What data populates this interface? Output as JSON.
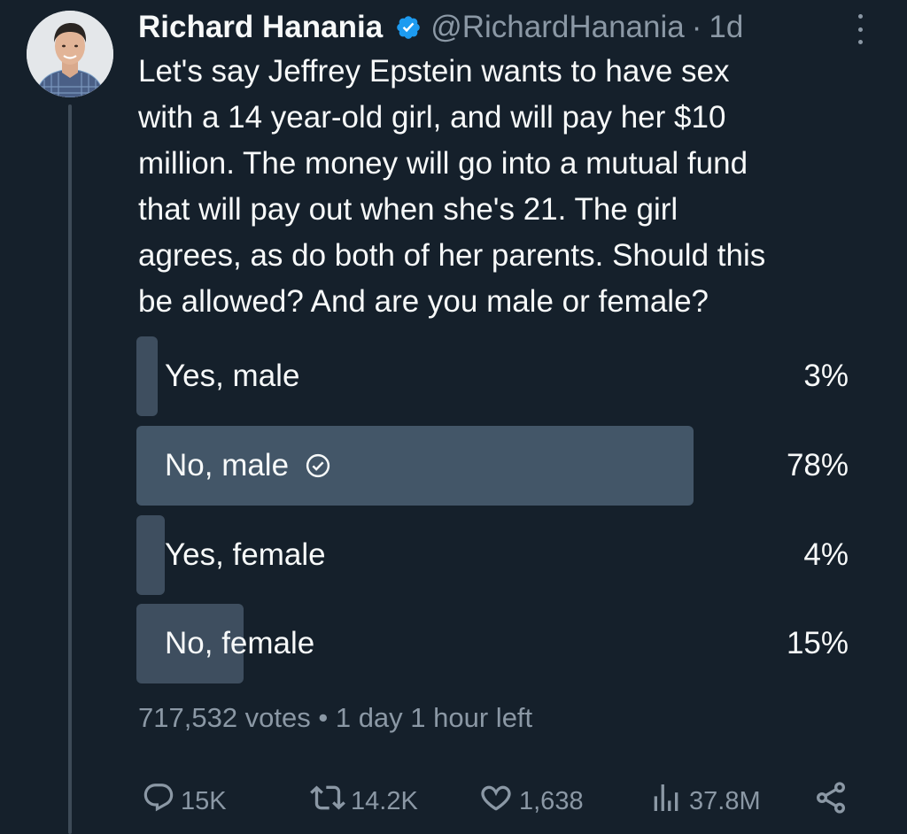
{
  "tweet": {
    "author_name": "Richard Hanania",
    "handle": "@RichardHanania",
    "separator": "·",
    "time": "1d",
    "text": "Let's say Jeffrey Epstein wants to have sex\nwith a 14 year-old girl, and will pay her $10\nmillion. The money will go into a mutual fund\nthat will pay out when she's 21. The girl\nagrees, as do both of her parents. Should this\nbe allowed? And are you male or female?"
  },
  "poll": {
    "options": [
      {
        "label": "Yes, male",
        "percent_text": "3%",
        "percent": 3,
        "selected": false
      },
      {
        "label": "No, male",
        "percent_text": "78%",
        "percent": 78,
        "selected": true
      },
      {
        "label": "Yes, female",
        "percent_text": "4%",
        "percent": 4,
        "selected": false
      },
      {
        "label": "No, female",
        "percent_text": "15%",
        "percent": 15,
        "selected": false
      }
    ],
    "summary": "717,532 votes • 1 day 1 hour left"
  },
  "actions": {
    "replies": "15K",
    "reposts": "14.2K",
    "likes": "1,638",
    "views": "37.8M"
  },
  "colors": {
    "background": "#15202b",
    "poll_bar": "#3e4e5f",
    "poll_bar_winner": "#435668",
    "muted_text": "#8b98a5",
    "verified": "#1d9bf0"
  },
  "icons": [
    "verified-badge-icon",
    "more-icon",
    "check-circle-icon",
    "reply-icon",
    "repost-icon",
    "like-icon",
    "views-icon",
    "share-icon"
  ]
}
